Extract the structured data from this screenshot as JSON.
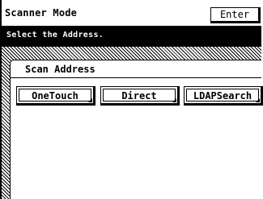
{
  "header": {
    "title": "Scanner Mode",
    "enter_label": "Enter"
  },
  "message": {
    "text": "Select the Address."
  },
  "section": {
    "label": "Scan Address"
  },
  "tabs": [
    {
      "label": "OneTouch"
    },
    {
      "label": "Direct"
    },
    {
      "label": "LDAPSearch"
    }
  ]
}
